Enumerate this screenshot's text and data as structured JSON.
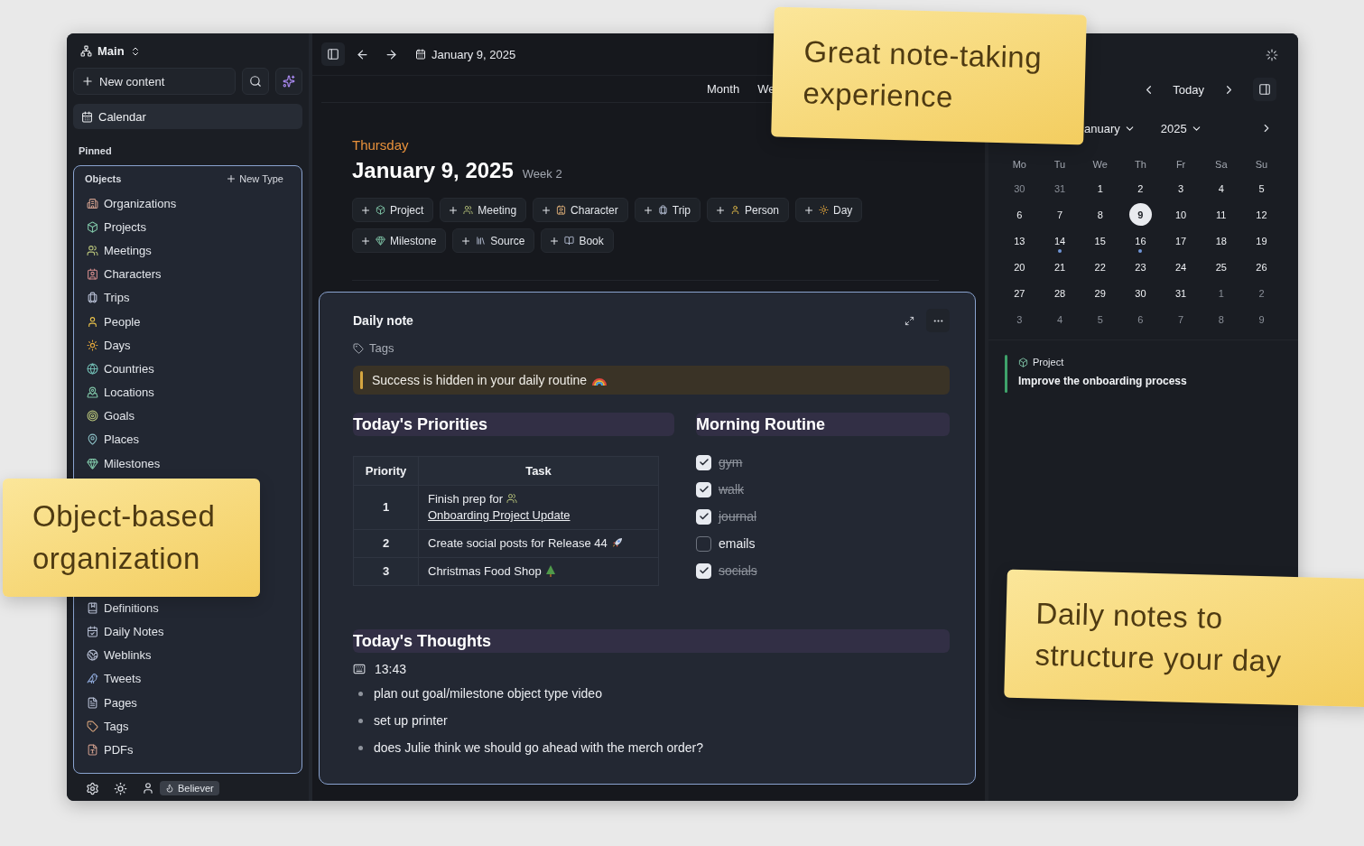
{
  "sidebar": {
    "workspace": "Main",
    "new_content": "New content",
    "calendar": "Calendar",
    "pinned_label": "Pinned",
    "objects": {
      "title": "Objects",
      "new_type": "New Type",
      "items": [
        "Organizations",
        "Projects",
        "Meetings",
        "Characters",
        "Trips",
        "People",
        "Days",
        "Countries",
        "Locations",
        "Goals",
        "Places",
        "Milestones"
      ],
      "more_items": [
        "Definitions",
        "Daily Notes",
        "Weblinks",
        "Tweets",
        "Pages",
        "Tags",
        "PDFs"
      ]
    },
    "plan_badge": "Believer"
  },
  "toolbar": {
    "date": "January 9, 2025"
  },
  "views": [
    {
      "label": "Month",
      "selected": false
    },
    {
      "label": "We",
      "selected": false
    }
  ],
  "day": {
    "weekday": "Thursday",
    "date": "January 9, 2025",
    "week": "Week 2",
    "quick_add": [
      "Project",
      "Meeting",
      "Character",
      "Trip",
      "Person",
      "Day",
      "Milestone",
      "Source",
      "Book"
    ]
  },
  "note": {
    "title": "Daily note",
    "tags": "Tags",
    "quote": "Success is hidden in your daily routine",
    "priorities": {
      "heading": "Today's Priorities",
      "columns": [
        "Priority",
        "Task"
      ],
      "rows": [
        {
          "priority": "1",
          "task": "Finish prep for",
          "link": "Onboarding Project Update",
          "kind": "meeting"
        },
        {
          "priority": "2",
          "task": "Create social posts for Release 44",
          "kind": "rocket"
        },
        {
          "priority": "3",
          "task": "Christmas Food Shop",
          "kind": "tree"
        }
      ]
    },
    "routine": {
      "heading": "Morning Routine",
      "items": [
        {
          "label": "gym",
          "checked": true
        },
        {
          "label": "walk",
          "checked": true
        },
        {
          "label": "journal",
          "checked": true
        },
        {
          "label": "emails",
          "checked": false
        },
        {
          "label": "socials",
          "checked": true
        }
      ]
    },
    "thoughts": {
      "heading": "Today's Thoughts",
      "time": "13:43",
      "bullets": [
        "plan out goal/milestone object type video",
        "set up printer",
        "does Julie think we should go ahead with the merch order?"
      ]
    }
  },
  "calendar": {
    "today": "Today",
    "month": "anuary",
    "year": "2025",
    "weekdays": [
      "Mo",
      "Tu",
      "We",
      "Th",
      "Fr",
      "Sa",
      "Su"
    ],
    "weeks": [
      [
        {
          "day": "30",
          "muted": true
        },
        {
          "day": "31",
          "muted": true
        },
        {
          "day": "1",
          "muted": false
        },
        {
          "day": "2",
          "muted": false
        },
        {
          "day": "3",
          "muted": false
        },
        {
          "day": "4",
          "muted": false
        },
        {
          "day": "5",
          "muted": false
        }
      ],
      [
        {
          "day": "6",
          "muted": false
        },
        {
          "day": "7",
          "muted": false
        },
        {
          "day": "8",
          "muted": false
        },
        {
          "day": "9",
          "muted": false,
          "selected": true
        },
        {
          "day": "10",
          "muted": false
        },
        {
          "day": "11",
          "muted": false
        },
        {
          "day": "12",
          "muted": false
        }
      ],
      [
        {
          "day": "13",
          "muted": false
        },
        {
          "day": "14",
          "muted": false,
          "dot": true
        },
        {
          "day": "15",
          "muted": false
        },
        {
          "day": "16",
          "muted": false,
          "dot": true
        },
        {
          "day": "17",
          "muted": false
        },
        {
          "day": "18",
          "muted": false
        },
        {
          "day": "19",
          "muted": false
        }
      ],
      [
        {
          "day": "20",
          "muted": false
        },
        {
          "day": "21",
          "muted": false
        },
        {
          "day": "22",
          "muted": false
        },
        {
          "day": "23",
          "muted": false
        },
        {
          "day": "24",
          "muted": false
        },
        {
          "day": "25",
          "muted": false
        },
        {
          "day": "26",
          "muted": false
        }
      ],
      [
        {
          "day": "27",
          "muted": false
        },
        {
          "day": "28",
          "muted": false
        },
        {
          "day": "29",
          "muted": false
        },
        {
          "day": "30",
          "muted": false
        },
        {
          "day": "31",
          "muted": false
        },
        {
          "day": "1",
          "muted": true
        },
        {
          "day": "2",
          "muted": true
        }
      ],
      [
        {
          "day": "3",
          "muted": true
        },
        {
          "day": "4",
          "muted": true
        },
        {
          "day": "5",
          "muted": true
        },
        {
          "day": "6",
          "muted": true
        },
        {
          "day": "7",
          "muted": true
        },
        {
          "day": "8",
          "muted": true
        },
        {
          "day": "9",
          "muted": true
        }
      ]
    ],
    "event": {
      "type": "Project",
      "title": "Improve the onboarding process",
      "color": "#3fa36b"
    }
  },
  "stickies": [
    {
      "text": "Great note-taking experience"
    },
    {
      "text": "Object-based organization"
    },
    {
      "text": "Daily notes to structure your day"
    }
  ]
}
